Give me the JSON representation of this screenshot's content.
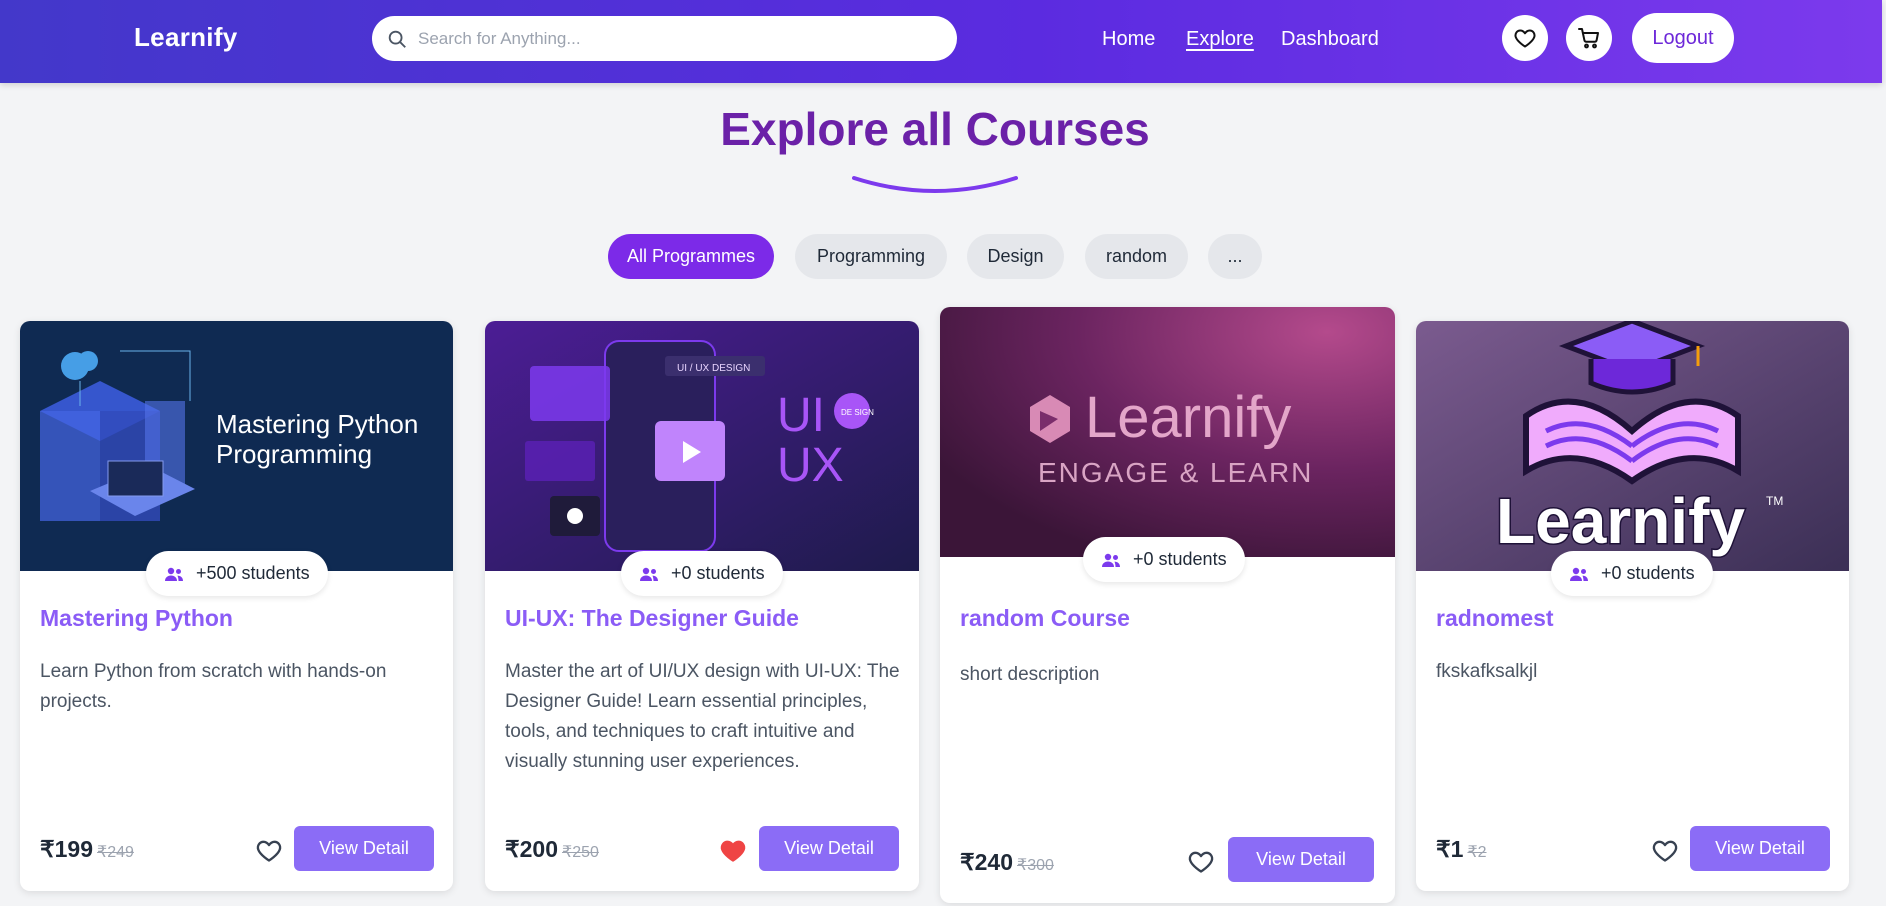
{
  "header": {
    "logo": "Learnify",
    "search_placeholder": "Search for Anything...",
    "nav": [
      "Home",
      "Explore",
      "Dashboard"
    ],
    "logout_label": "Logout"
  },
  "page": {
    "title": "Explore all Courses",
    "filters": [
      "All Programmes",
      "Programming",
      "Design",
      "random",
      "..."
    ]
  },
  "courses": [
    {
      "thumb_text": [
        "Mastering Python",
        "Programming"
      ],
      "students": "+500 students",
      "title": "Mastering Python",
      "description": "Learn Python from scratch with hands-on projects.",
      "price": "₹199",
      "old_price": "₹249",
      "favorited": false,
      "button": "View Detail"
    },
    {
      "thumb_text": [
        "UI",
        "UX",
        "UI / UX DESIGN",
        "DE SIGN"
      ],
      "students": "+0 students",
      "title": "UI-UX: The Designer Guide",
      "description": "Master the art of UI/UX design with UI-UX: The Designer Guide! Learn essential principles, tools, and techniques to craft intuitive and visually stunning user experiences.",
      "price": "₹200",
      "old_price": "₹250",
      "favorited": true,
      "button": "View Detail"
    },
    {
      "thumb_text": [
        "Learnify",
        "ENGAGE & LEARN"
      ],
      "students": "+0 students",
      "title": "random Course",
      "description": "short description",
      "price": "₹240",
      "old_price": "₹300",
      "favorited": false,
      "button": "View Detail"
    },
    {
      "thumb_text": [
        "Learnify",
        "TM"
      ],
      "students": "+0 students",
      "title": "radnomest",
      "description": "fkskafksalkjl",
      "price": "₹1",
      "old_price": "₹2",
      "favorited": false,
      "button": "View Detail"
    }
  ],
  "colors": {
    "header_gradient_start": "#4338ca",
    "header_gradient_end": "#7c3aed",
    "title": "#6b21a8",
    "accent": "#7c2ae8",
    "button": "#8b6cf6",
    "heart_active": "#ef4444"
  }
}
